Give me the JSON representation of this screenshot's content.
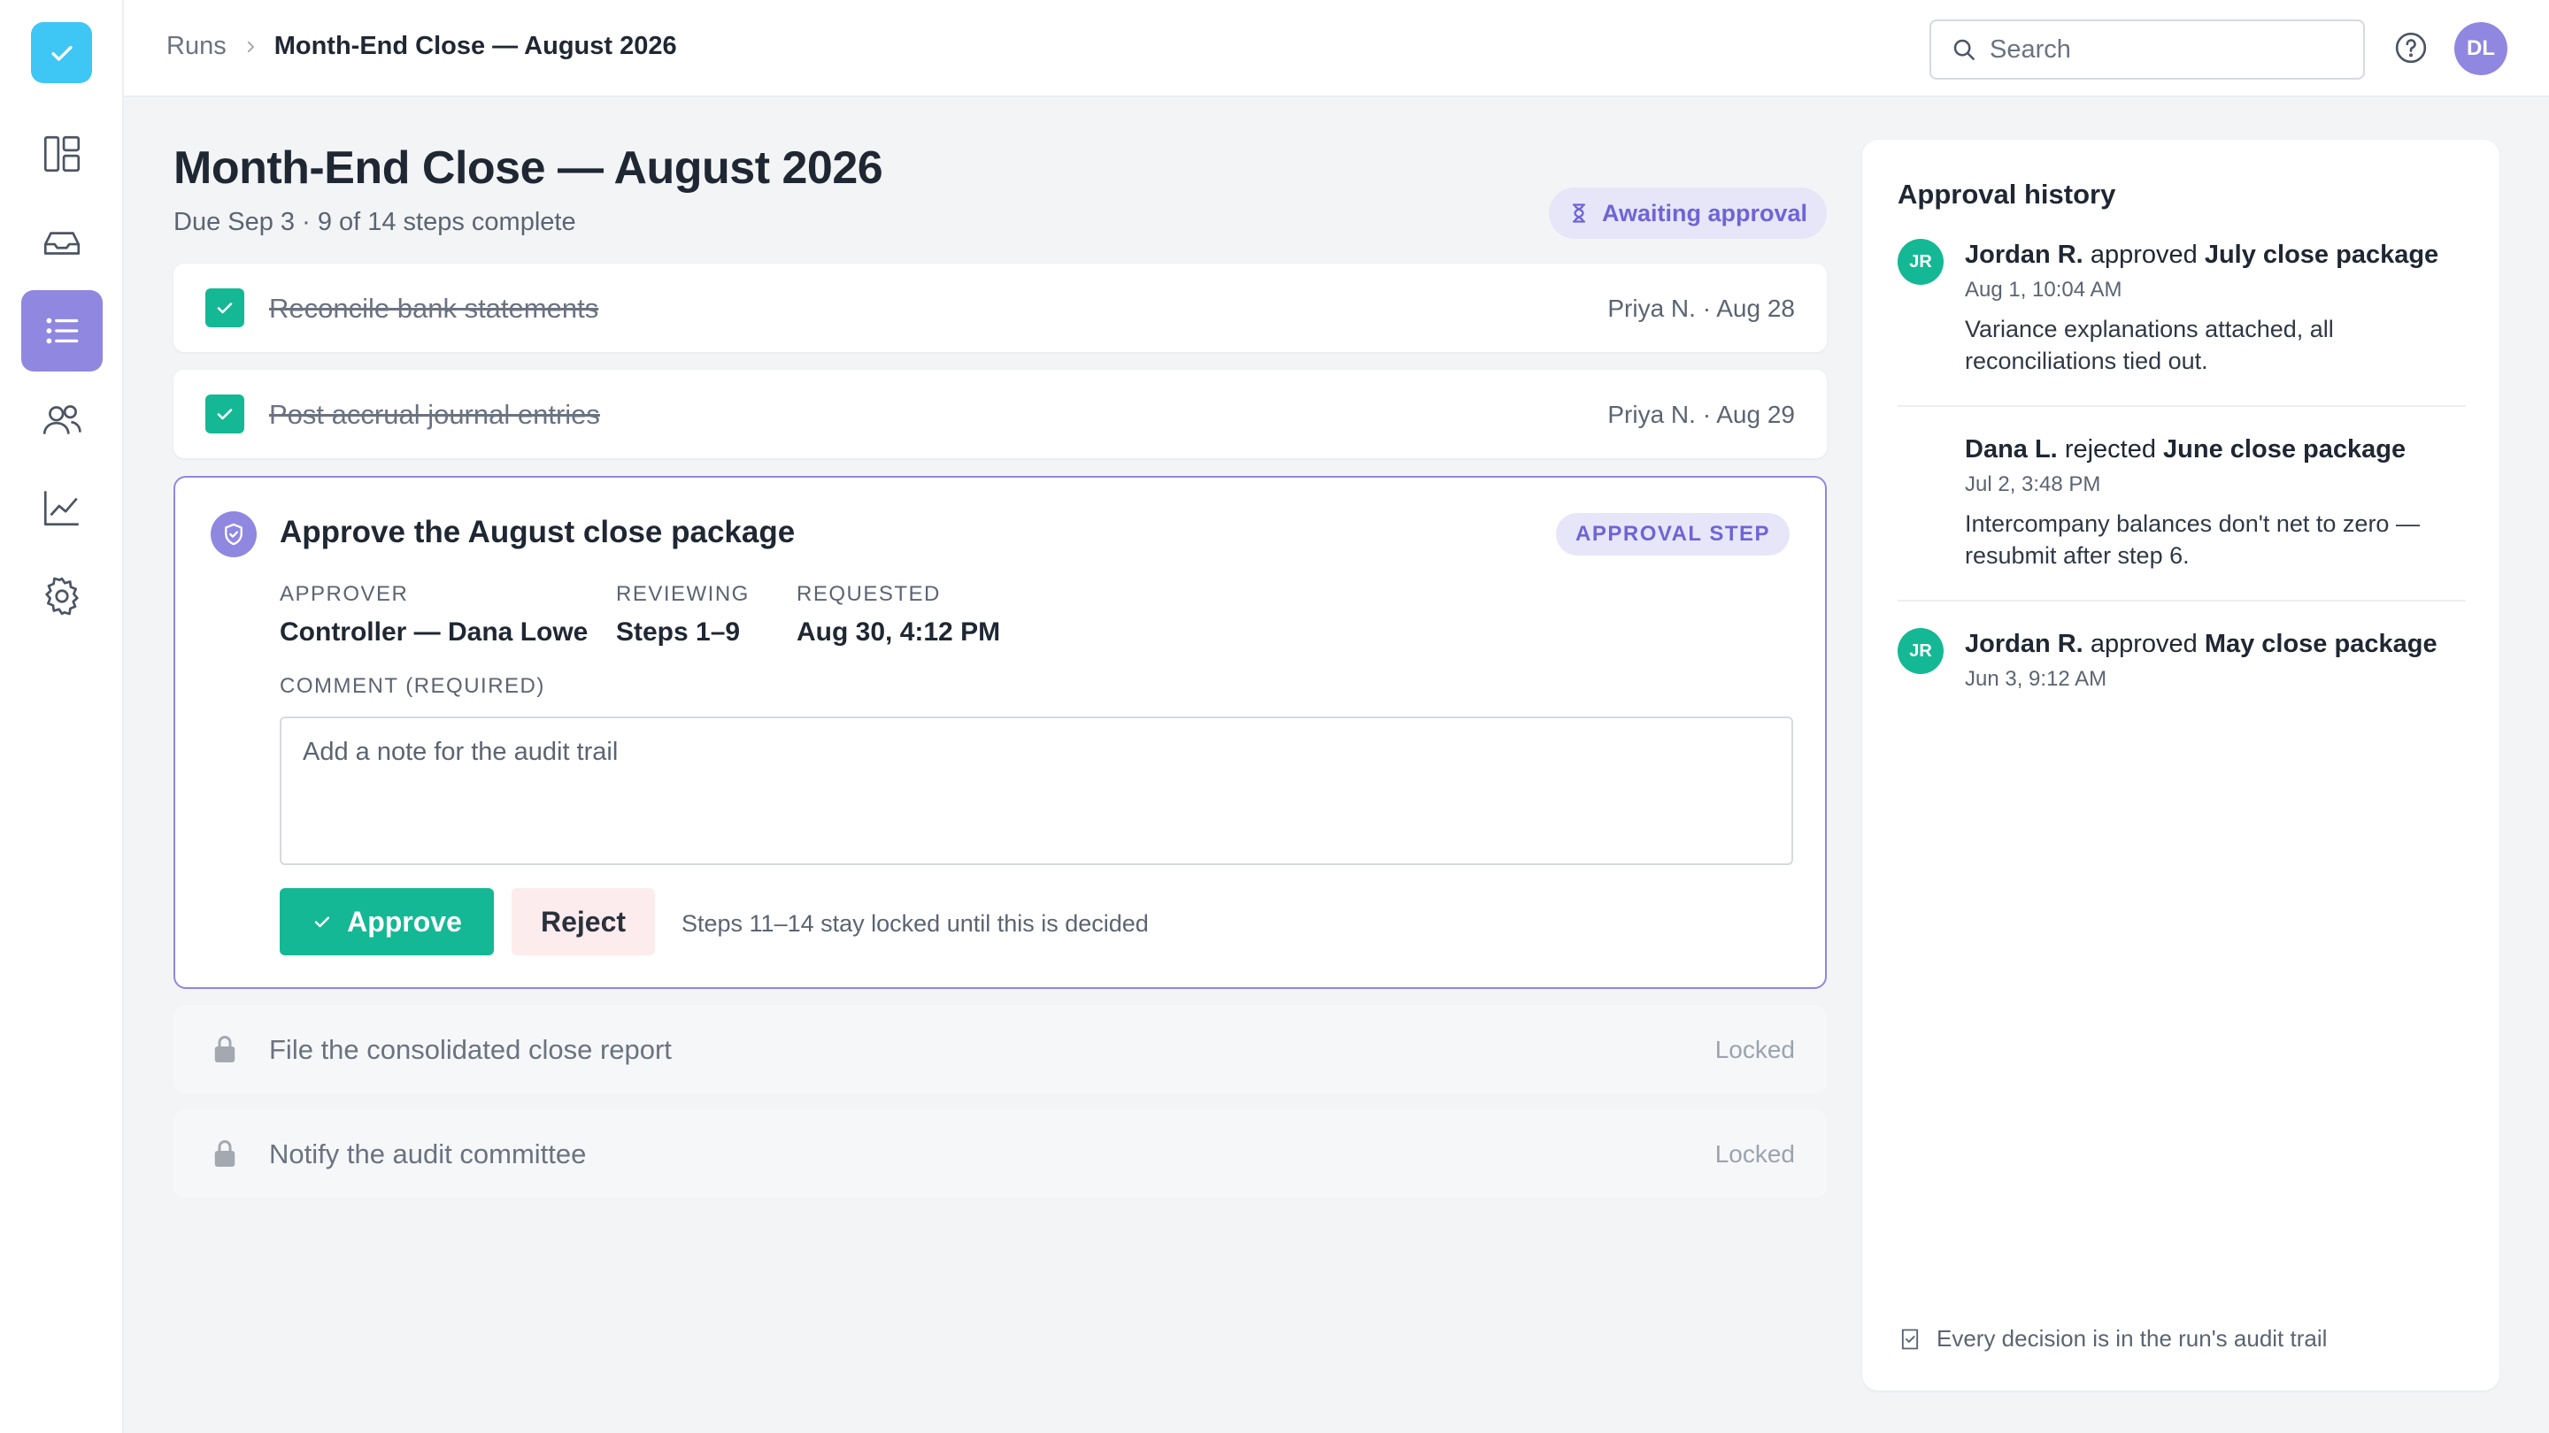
{
  "app": {
    "logo_icon": "check-logo-icon",
    "brand_color": "#3ec6f5",
    "accent_color": "#8f87e0"
  },
  "sidebar": {
    "items": [
      {
        "icon": "dashboard-icon"
      },
      {
        "icon": "inbox-icon"
      },
      {
        "icon": "list-icon",
        "active": true
      },
      {
        "icon": "users-icon"
      },
      {
        "icon": "chart-icon"
      },
      {
        "icon": "settings-icon"
      }
    ]
  },
  "header": {
    "breadcrumb": {
      "parent": "Runs",
      "current": "Month-End Close — August 2026"
    },
    "search": {
      "placeholder": "Search",
      "value": ""
    },
    "avatar_initials": "DL"
  },
  "main": {
    "title": "Month-End Close — August 2026",
    "subtitle": "Due Sep 3 · 9 of 14 steps complete",
    "status": "Awaiting approval",
    "steps": [
      {
        "title": "Reconcile bank statements",
        "meta": "Priya N. · Aug 28",
        "state": "done"
      },
      {
        "title": "Post accrual journal entries",
        "meta": "Priya N. · Aug 29",
        "state": "done"
      }
    ],
    "approval": {
      "title": "Approve the August close package",
      "badge": "APPROVAL STEP",
      "approver_label": "APPROVER",
      "approver_value": "Controller — Dana Lowe",
      "reviewing_label": "REVIEWING",
      "reviewing_value": "Steps 1–9",
      "requested_label": "REQUESTED",
      "requested_value": "Aug 30, 4:12 PM",
      "comment_label": "COMMENT (REQUIRED)",
      "comment_placeholder": "Add a note for the audit trail",
      "comment_value": "",
      "approve_label": "Approve",
      "reject_label": "Reject",
      "lock_note": "Steps 11–14 stay locked until this is decided"
    },
    "locked_steps": [
      {
        "title": "File the consolidated close report",
        "meta": "Locked"
      },
      {
        "title": "Notify the audit committee",
        "meta": "Locked"
      }
    ]
  },
  "history": {
    "title": "Approval history",
    "entries": [
      {
        "initials": "JR",
        "actor": "Jordan R.",
        "action": "approved",
        "subject": "July close package",
        "time": "Aug 1, 10:04 AM",
        "note": "Variance explanations attached, all reconciliations tied out."
      },
      {
        "initials": "",
        "actor": "Dana L.",
        "action": "rejected",
        "subject": "June close package",
        "time": "Jul 2, 3:48 PM",
        "note": "Intercompany balances don't net to zero — resubmit after step 6."
      },
      {
        "initials": "JR",
        "actor": "Jordan R.",
        "action": "approved",
        "subject": "May close package",
        "time": "Jun 3, 9:12 AM",
        "note": ""
      }
    ],
    "footer": "Every decision is in the run's audit trail"
  }
}
